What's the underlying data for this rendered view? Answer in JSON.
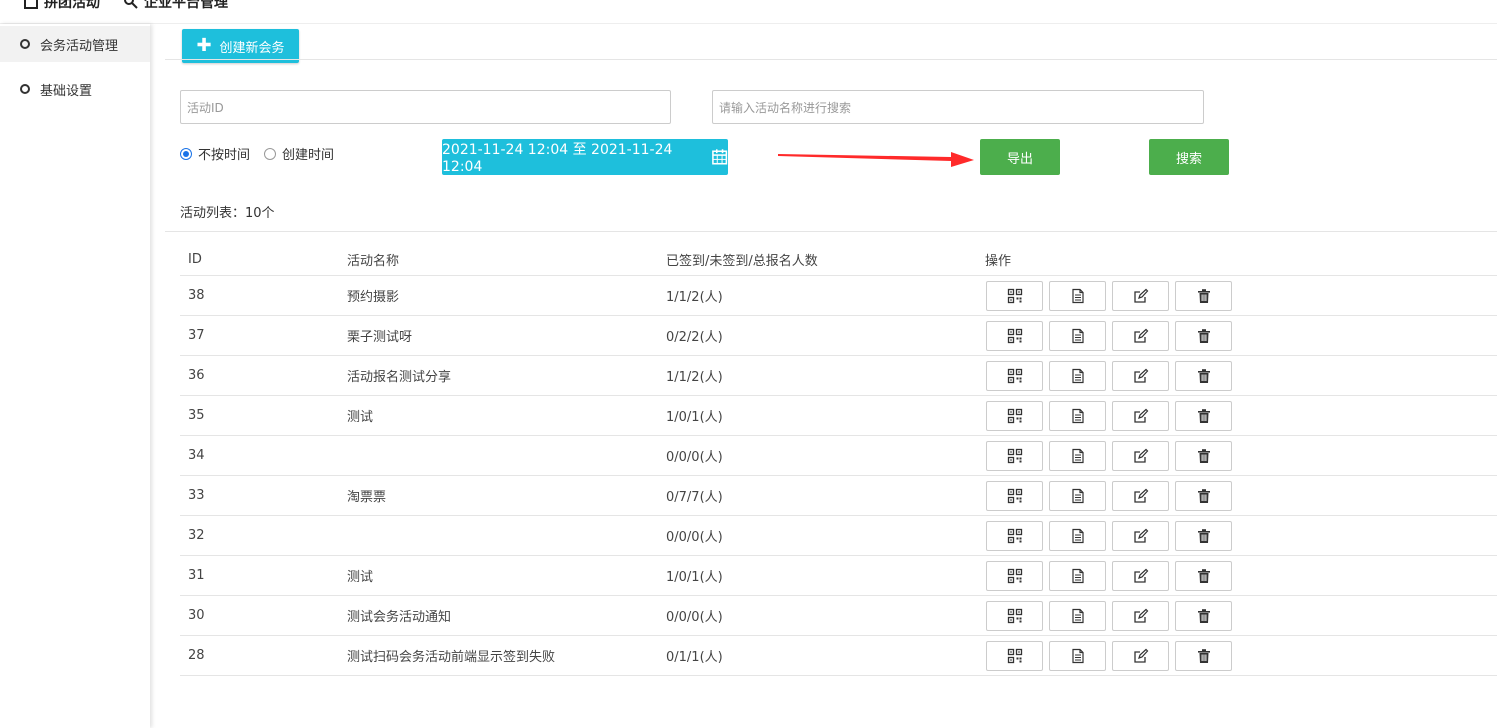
{
  "topnav": {
    "item1": "拼团活动",
    "item2": "企业平台管理"
  },
  "sidebar": {
    "items": [
      {
        "label": "会务活动管理",
        "active": true
      },
      {
        "label": "基础设置",
        "active": false
      }
    ]
  },
  "toolbar": {
    "create_label": "创建新会务"
  },
  "filters": {
    "id_placeholder": "活动ID",
    "name_placeholder": "请输入活动名称进行搜索",
    "radio_no_time": "不按时间",
    "radio_create_time": "创建时间",
    "date_range": "2021-11-24 12:04 至 2021-11-24 12:04",
    "export_label": "导出",
    "search_label": "搜索"
  },
  "list": {
    "count_text": "活动列表：10个",
    "headers": {
      "id": "ID",
      "name": "活动名称",
      "count": "已签到/未签到/总报名人数",
      "ops": "操作"
    },
    "rows": [
      {
        "id": "38",
        "name": "预约摄影",
        "count": "1/1/2(人)"
      },
      {
        "id": "37",
        "name": "栗子测试呀",
        "count": "0/2/2(人)"
      },
      {
        "id": "36",
        "name": "活动报名测试分享",
        "count": "1/1/2(人)"
      },
      {
        "id": "35",
        "name": "测试",
        "count": "1/0/1(人)"
      },
      {
        "id": "34",
        "name": "",
        "count": "0/0/0(人)"
      },
      {
        "id": "33",
        "name": "淘票票",
        "count": "0/7/7(人)"
      },
      {
        "id": "32",
        "name": "",
        "count": "0/0/0(人)"
      },
      {
        "id": "31",
        "name": "测试",
        "count": "1/0/1(人)"
      },
      {
        "id": "30",
        "name": "测试会务活动通知",
        "count": "0/0/0(人)"
      },
      {
        "id": "28",
        "name": "测试扫码会务活动前端显示签到失败",
        "count": "0/1/1(人)"
      }
    ]
  },
  "colors": {
    "cyan": "#1ebfdc",
    "green": "#4cae4c",
    "arrow": "#ff2a2a"
  }
}
